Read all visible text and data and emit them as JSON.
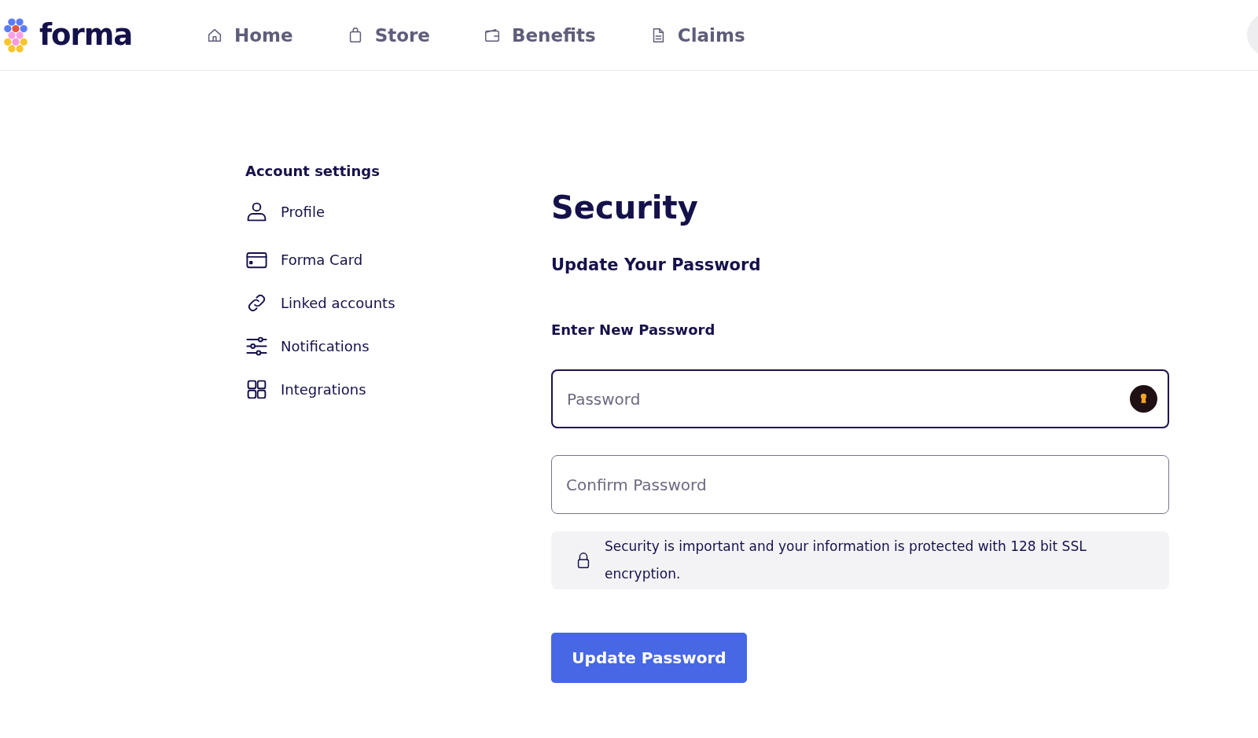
{
  "header": {
    "logo": "forma",
    "nav": [
      {
        "label": "Home"
      },
      {
        "label": "Store"
      },
      {
        "label": "Benefits"
      },
      {
        "label": "Claims"
      }
    ]
  },
  "sidebar": {
    "title": "Account settings",
    "items": [
      {
        "label": "Profile"
      },
      {
        "label": "Forma Card"
      },
      {
        "label": "Linked accounts"
      },
      {
        "label": "Notifications"
      },
      {
        "label": "Integrations"
      }
    ]
  },
  "main": {
    "title": "Security",
    "subtitle": "Update Your Password",
    "field_label": "Enter New Password",
    "fields": [
      {
        "placeholder": "Password",
        "focused": true,
        "key_badge": true
      },
      {
        "placeholder": "Confirm Password",
        "focused": false,
        "key_badge": false
      }
    ],
    "notice": "Security is important and your information is protected with 128 bit SSL encryption.",
    "button": "Update Password"
  }
}
